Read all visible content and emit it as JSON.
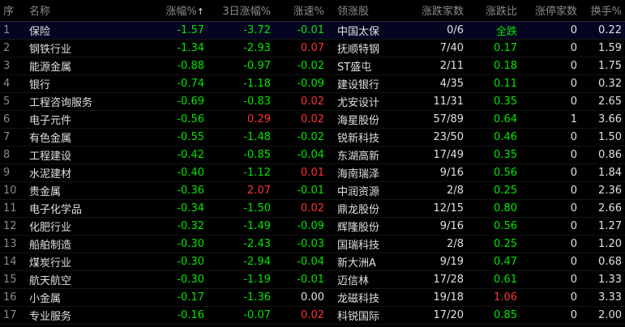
{
  "columns": {
    "idx": "序",
    "name": "名称",
    "change_pct": "涨幅%",
    "sort_arrow": "↑",
    "change_3d": "3日涨幅%",
    "speed": "涨速%",
    "leader": "领涨股",
    "up_down_count": "涨跌家数",
    "up_down_ratio": "涨跌比",
    "limit_up_count": "涨停家数",
    "turnover": "换手%"
  },
  "colors": {
    "up": "#ff3232",
    "down": "#00e600",
    "flat": "#e0e0e0"
  },
  "rows": [
    {
      "idx": "1",
      "name": "保险",
      "change_pct": "-1.57",
      "change_3d": "-3.72",
      "speed": "-0.01",
      "leader": "中国太保",
      "up_down_count": "0/6",
      "up_down_ratio": "全跌",
      "limit_up_count": "0",
      "turnover": "0.22"
    },
    {
      "idx": "2",
      "name": "钢铁行业",
      "change_pct": "-1.34",
      "change_3d": "-2.93",
      "speed": "0.07",
      "leader": "抚顺特钢",
      "up_down_count": "7/40",
      "up_down_ratio": "0.17",
      "limit_up_count": "0",
      "turnover": "1.59"
    },
    {
      "idx": "3",
      "name": "能源金属",
      "change_pct": "-0.88",
      "change_3d": "-0.97",
      "speed": "-0.02",
      "leader": "ST盛屯",
      "up_down_count": "2/11",
      "up_down_ratio": "0.18",
      "limit_up_count": "0",
      "turnover": "1.75"
    },
    {
      "idx": "4",
      "name": "银行",
      "change_pct": "-0.74",
      "change_3d": "-1.18",
      "speed": "-0.09",
      "leader": "建设银行",
      "up_down_count": "4/35",
      "up_down_ratio": "0.11",
      "limit_up_count": "0",
      "turnover": "0.32"
    },
    {
      "idx": "5",
      "name": "工程咨询服务",
      "change_pct": "-0.69",
      "change_3d": "-0.83",
      "speed": "0.02",
      "leader": "尤安设计",
      "up_down_count": "11/31",
      "up_down_ratio": "0.35",
      "limit_up_count": "0",
      "turnover": "2.65"
    },
    {
      "idx": "6",
      "name": "电子元件",
      "change_pct": "-0.56",
      "change_3d": "0.29",
      "speed": "0.02",
      "leader": "海星股份",
      "up_down_count": "57/89",
      "up_down_ratio": "0.64",
      "limit_up_count": "1",
      "turnover": "3.66"
    },
    {
      "idx": "7",
      "name": "有色金属",
      "change_pct": "-0.55",
      "change_3d": "-1.48",
      "speed": "-0.02",
      "leader": "锐新科技",
      "up_down_count": "23/50",
      "up_down_ratio": "0.46",
      "limit_up_count": "0",
      "turnover": "1.50"
    },
    {
      "idx": "8",
      "name": "工程建设",
      "change_pct": "-0.42",
      "change_3d": "-0.85",
      "speed": "-0.04",
      "leader": "东湖高新",
      "up_down_count": "17/49",
      "up_down_ratio": "0.35",
      "limit_up_count": "0",
      "turnover": "0.86"
    },
    {
      "idx": "9",
      "name": "水泥建材",
      "change_pct": "-0.40",
      "change_3d": "-1.12",
      "speed": "0.01",
      "leader": "海南瑞泽",
      "up_down_count": "9/16",
      "up_down_ratio": "0.56",
      "limit_up_count": "0",
      "turnover": "1.84"
    },
    {
      "idx": "10",
      "name": "贵金属",
      "change_pct": "-0.36",
      "change_3d": "2.07",
      "speed": "-0.01",
      "leader": "中润资源",
      "up_down_count": "2/8",
      "up_down_ratio": "0.25",
      "limit_up_count": "0",
      "turnover": "2.36"
    },
    {
      "idx": "11",
      "name": "电子化学品",
      "change_pct": "-0.34",
      "change_3d": "-1.50",
      "speed": "0.02",
      "leader": "鼎龙股份",
      "up_down_count": "12/15",
      "up_down_ratio": "0.80",
      "limit_up_count": "0",
      "turnover": "2.66"
    },
    {
      "idx": "12",
      "name": "化肥行业",
      "change_pct": "-0.32",
      "change_3d": "-1.49",
      "speed": "-0.09",
      "leader": "辉隆股份",
      "up_down_count": "9/16",
      "up_down_ratio": "0.56",
      "limit_up_count": "0",
      "turnover": "1.27"
    },
    {
      "idx": "13",
      "name": "船舶制造",
      "change_pct": "-0.30",
      "change_3d": "-2.43",
      "speed": "-0.03",
      "leader": "国瑞科技",
      "up_down_count": "2/8",
      "up_down_ratio": "0.25",
      "limit_up_count": "0",
      "turnover": "1.20"
    },
    {
      "idx": "14",
      "name": "煤炭行业",
      "change_pct": "-0.30",
      "change_3d": "-2.94",
      "speed": "-0.04",
      "leader": "新大洲A",
      "up_down_count": "9/19",
      "up_down_ratio": "0.47",
      "limit_up_count": "0",
      "turnover": "0.68"
    },
    {
      "idx": "15",
      "name": "航天航空",
      "change_pct": "-0.30",
      "change_3d": "-1.19",
      "speed": "-0.01",
      "leader": "迈信林",
      "up_down_count": "17/28",
      "up_down_ratio": "0.61",
      "limit_up_count": "0",
      "turnover": "1.33"
    },
    {
      "idx": "16",
      "name": "小金属",
      "change_pct": "-0.17",
      "change_3d": "-1.36",
      "speed": "0.00",
      "leader": "龙磁科技",
      "up_down_count": "19/18",
      "up_down_ratio": "1.06",
      "limit_up_count": "0",
      "turnover": "3.33"
    },
    {
      "idx": "17",
      "name": "专业服务",
      "change_pct": "-0.16",
      "change_3d": "-0.07",
      "speed": "0.02",
      "leader": "科锐国际",
      "up_down_count": "17/20",
      "up_down_ratio": "0.85",
      "limit_up_count": "0",
      "turnover": "2.00"
    }
  ]
}
